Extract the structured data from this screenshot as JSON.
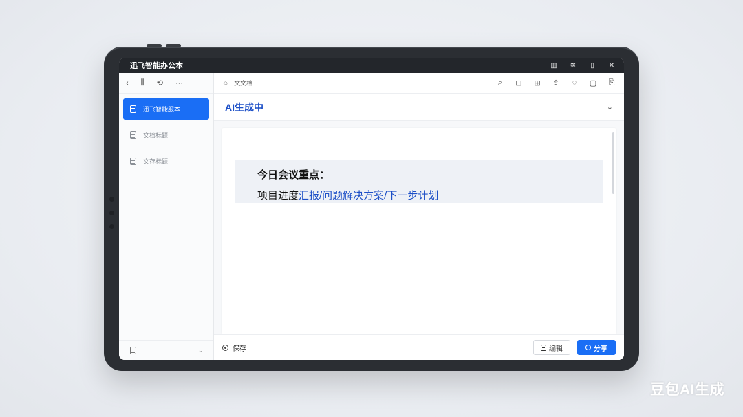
{
  "window": {
    "title": "迅飞智能办公本",
    "controls": [
      "▥",
      "≋",
      "▯",
      "✕"
    ]
  },
  "sidebar": {
    "top_icons": [
      "‹",
      "⫼",
      "⟲",
      "···"
    ],
    "items": [
      {
        "label": "迅飞智能服本",
        "active": true
      },
      {
        "label": "文档标题",
        "active": false
      },
      {
        "label": "文存标题",
        "active": false
      }
    ],
    "bottom_chevron": "⌄"
  },
  "toolbar": {
    "doc_icon": "☺",
    "doc_name": "文文档",
    "tools": [
      "⌕",
      "⊟",
      "⊞",
      "⇪",
      "◌",
      "▢",
      "⎘"
    ]
  },
  "ai_bar": {
    "title": "AI生成中",
    "chevron": "⌄"
  },
  "note": {
    "line1": "今日会议重点：",
    "line2_prefix": "项目进度",
    "line2_highlight": "汇报/问题解决方案/下一步计划"
  },
  "footer": {
    "save_label": "保存",
    "edit_label": "编辑",
    "share_label": "分享"
  },
  "watermark": "豆包AI生成",
  "colors": {
    "accent": "#1a6ef5",
    "ai_title": "#1c4fc7",
    "titlebar": "#23262b"
  }
}
